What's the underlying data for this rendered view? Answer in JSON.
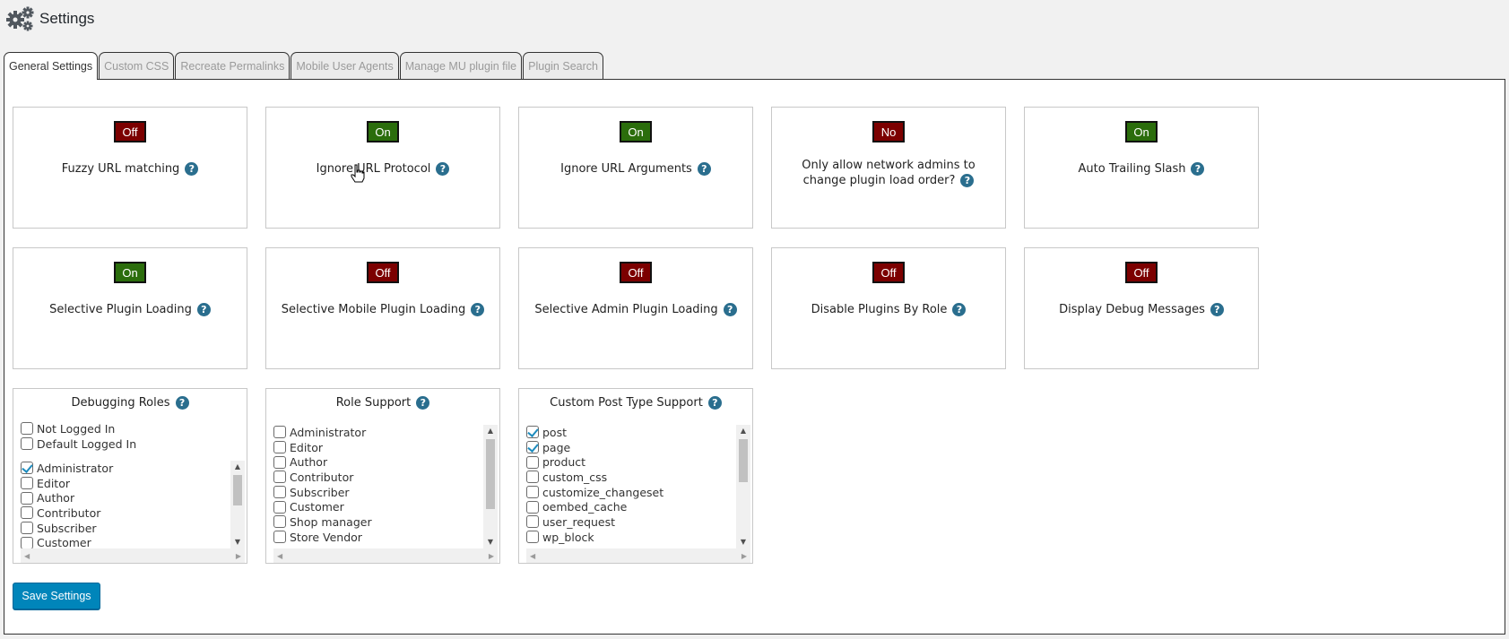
{
  "page": {
    "title": "Settings"
  },
  "tabs": [
    {
      "label": "General Settings",
      "active": true
    },
    {
      "label": "Custom CSS",
      "active": false
    },
    {
      "label": "Recreate Permalinks",
      "active": false
    },
    {
      "label": "Mobile User Agents",
      "active": false
    },
    {
      "label": "Manage MU plugin file",
      "active": false
    },
    {
      "label": "Plugin Search",
      "active": false
    }
  ],
  "toggles": [
    {
      "state": "Off",
      "label": "Fuzzy URL matching"
    },
    {
      "state": "On",
      "label": "Ignore URL Protocol"
    },
    {
      "state": "On",
      "label": "Ignore URL Arguments"
    },
    {
      "state": "No",
      "label": "Only allow network admins to change plugin load order?"
    },
    {
      "state": "On",
      "label": "Auto Trailing Slash"
    },
    {
      "state": "On",
      "label": "Selective Plugin Loading"
    },
    {
      "state": "Off",
      "label": "Selective Mobile Plugin Loading"
    },
    {
      "state": "Off",
      "label": "Selective Admin Plugin Loading"
    },
    {
      "state": "Off",
      "label": "Disable Plugins By Role"
    },
    {
      "state": "Off",
      "label": "Display Debug Messages"
    }
  ],
  "lists": {
    "debugging_roles": {
      "title": "Debugging Roles",
      "fixed_items": [
        {
          "label": "Not Logged In",
          "checked": false
        },
        {
          "label": "Default Logged In",
          "checked": false
        }
      ],
      "items": [
        {
          "label": "Administrator",
          "checked": true
        },
        {
          "label": "Editor",
          "checked": false
        },
        {
          "label": "Author",
          "checked": false
        },
        {
          "label": "Contributor",
          "checked": false
        },
        {
          "label": "Subscriber",
          "checked": false
        },
        {
          "label": "Customer",
          "checked": false
        }
      ]
    },
    "role_support": {
      "title": "Role Support",
      "items": [
        {
          "label": "Administrator",
          "checked": false
        },
        {
          "label": "Editor",
          "checked": false
        },
        {
          "label": "Author",
          "checked": false
        },
        {
          "label": "Contributor",
          "checked": false
        },
        {
          "label": "Subscriber",
          "checked": false
        },
        {
          "label": "Customer",
          "checked": false
        },
        {
          "label": "Shop manager",
          "checked": false
        },
        {
          "label": "Store Vendor",
          "checked": false
        }
      ]
    },
    "custom_post_type_support": {
      "title": "Custom Post Type Support",
      "items": [
        {
          "label": "post",
          "checked": true
        },
        {
          "label": "page",
          "checked": true
        },
        {
          "label": "product",
          "checked": false
        },
        {
          "label": "custom_css",
          "checked": false
        },
        {
          "label": "customize_changeset",
          "checked": false
        },
        {
          "label": "oembed_cache",
          "checked": false
        },
        {
          "label": "user_request",
          "checked": false
        },
        {
          "label": "wp_block",
          "checked": false
        }
      ]
    }
  },
  "actions": {
    "save_label": "Save Settings"
  },
  "icons": {
    "help": "?",
    "header": "gears-icon"
  },
  "colors": {
    "on": "#2b6d0c",
    "off": "#7c0000",
    "primary": "#0085ba",
    "help": "#2a6e8e"
  }
}
